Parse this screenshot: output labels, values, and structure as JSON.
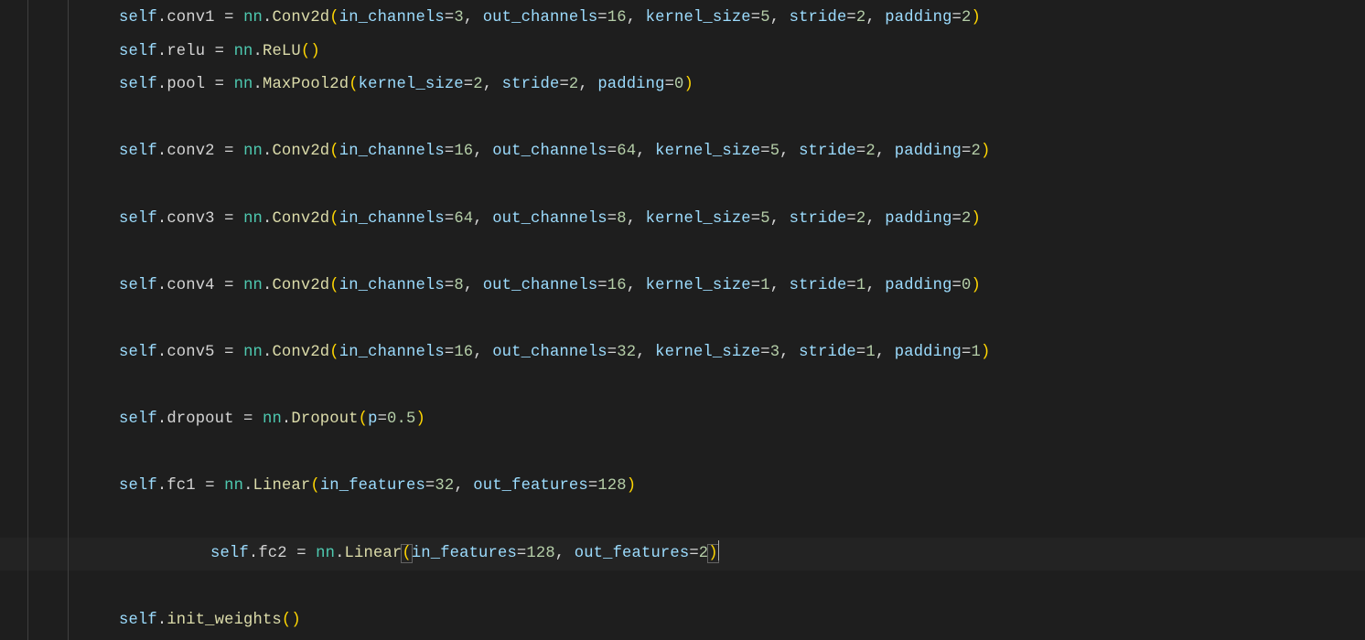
{
  "editor": {
    "indent_levels": 2,
    "highlight_line_index": 16,
    "tokens": {
      "self": "self",
      "dot": ".",
      "eq": " = ",
      "nn": "nn",
      "comma": ", ",
      "attrs": {
        "conv1": "conv1",
        "relu": "relu",
        "pool": "pool",
        "conv2": "conv2",
        "conv3": "conv3",
        "conv4": "conv4",
        "conv5": "conv5",
        "dropout": "dropout",
        "fc1": "fc1",
        "fc2": "fc2",
        "init_weights": "init_weights"
      },
      "calls": {
        "Conv2d": "Conv2d",
        "ReLU": "ReLU",
        "MaxPool2d": "MaxPool2d",
        "Dropout": "Dropout",
        "Linear": "Linear"
      },
      "kwargs": {
        "in_channels": "in_channels",
        "out_channels": "out_channels",
        "kernel_size": "kernel_size",
        "stride": "stride",
        "padding": "padding",
        "p": "p",
        "in_features": "in_features",
        "out_features": "out_features"
      }
    },
    "values": {
      "conv1": {
        "in_channels": "3",
        "out_channels": "16",
        "kernel_size": "5",
        "stride": "2",
        "padding": "2"
      },
      "pool": {
        "kernel_size": "2",
        "stride": "2",
        "padding": "0"
      },
      "conv2": {
        "in_channels": "16",
        "out_channels": "64",
        "kernel_size": "5",
        "stride": "2",
        "padding": "2"
      },
      "conv3": {
        "in_channels": "64",
        "out_channels": "8",
        "kernel_size": "5",
        "stride": "2",
        "padding": "2"
      },
      "conv4": {
        "in_channels": "8",
        "out_channels": "16",
        "kernel_size": "1",
        "stride": "1",
        "padding": "0"
      },
      "conv5": {
        "in_channels": "16",
        "out_channels": "32",
        "kernel_size": "3",
        "stride": "1",
        "padding": "1"
      },
      "dropout": {
        "p": "0.5"
      },
      "fc1": {
        "in_features": "32",
        "out_features": "128"
      },
      "fc2": {
        "in_features": "128",
        "out_features": "2"
      }
    }
  }
}
